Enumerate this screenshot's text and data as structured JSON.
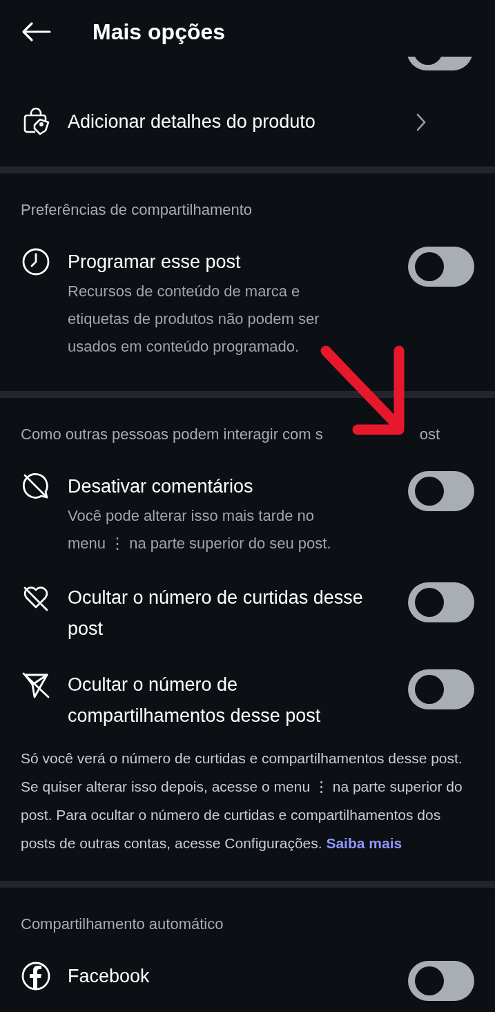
{
  "header": {
    "title": "Mais opções"
  },
  "sections": [
    {
      "rows": [
        {
          "kind": "clipped_toggle",
          "on": false
        },
        {
          "kind": "link",
          "title": "Adicionar detalhes do produto"
        }
      ]
    },
    {
      "label": "Preferências de compartilhamento",
      "rows": [
        {
          "kind": "toggle",
          "title": "Programar esse post",
          "description": "Recursos de conteúdo de marca e etiquetas de produtos não podem ser usados em conteúdo programado.",
          "on": false
        }
      ]
    },
    {
      "label": "Como outras pessoas podem interagir com s",
      "label_tail": "ost",
      "rows": [
        {
          "kind": "toggle",
          "title": "Desativar comentários",
          "description": "Você pode alterar isso mais tarde no menu ⋮ na parte superior do seu post.",
          "on": false
        },
        {
          "kind": "toggle",
          "title": "Ocultar o número de curtidas desse post",
          "on": false
        },
        {
          "kind": "toggle",
          "title": "Ocultar o número de compartilhamentos desse post",
          "on": false
        },
        {
          "kind": "note",
          "text": "Só você verá o número de curtidas e compartilhamentos desse post. Se quiser alterar isso depois, acesse o menu ⋮ na parte superior do post. Para ocultar o número de curtidas e compartilhamentos dos posts de outras contas, acesse Configurações.",
          "link": "Saiba mais"
        }
      ]
    },
    {
      "label": "Compartilhamento automático",
      "rows": [
        {
          "kind": "toggle",
          "title": "Facebook",
          "on": false
        }
      ]
    }
  ]
}
